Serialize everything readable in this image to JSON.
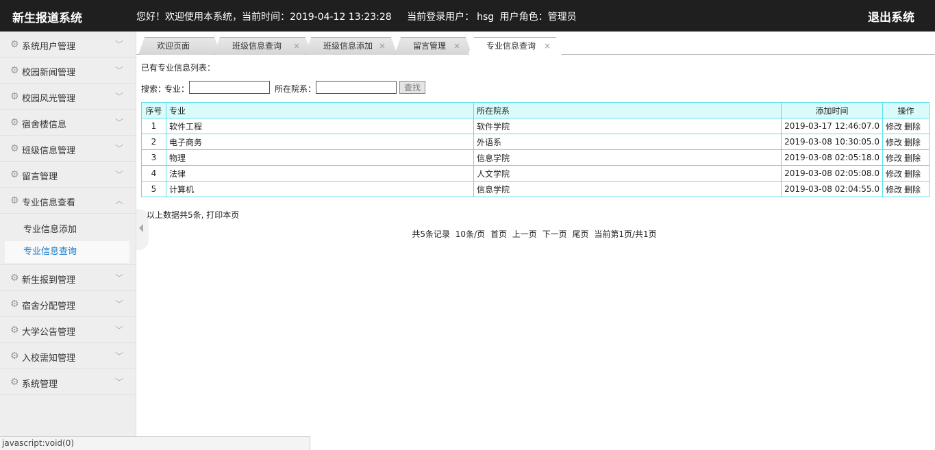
{
  "header": {
    "logo": "新生报道系统",
    "welcome": "您好！欢迎使用本系统，当前时间：2019-04-12 13:23:28",
    "user_label": "当前登录用户：",
    "user": "hsg",
    "role": "用户角色：管理员",
    "exit": "退出系统"
  },
  "sidebar": {
    "items": [
      {
        "label": "系统用户管理"
      },
      {
        "label": "校园新闻管理"
      },
      {
        "label": "校园风光管理"
      },
      {
        "label": "宿舍楼信息"
      },
      {
        "label": "班级信息管理"
      },
      {
        "label": "留言管理"
      },
      {
        "label": "专业信息查看"
      },
      {
        "label": "新生报到管理"
      },
      {
        "label": "宿舍分配管理"
      },
      {
        "label": "大学公告管理"
      },
      {
        "label": "入校需知管理"
      },
      {
        "label": "系统管理"
      }
    ],
    "sub_items": [
      {
        "label": "专业信息添加"
      },
      {
        "label": "专业信息查询"
      }
    ]
  },
  "tabs": [
    {
      "label": "欢迎页面"
    },
    {
      "label": "班级信息查询"
    },
    {
      "label": "班级信息添加"
    },
    {
      "label": "留言管理"
    },
    {
      "label": "专业信息查询"
    }
  ],
  "icons": {
    "tab_close": "×",
    "expand": "chevron-down-icon",
    "collapse": "chevron-up-icon",
    "menu": "gear-icon"
  },
  "main": {
    "list_title": "已有专业信息列表：",
    "search_label": "搜索：",
    "major_label": "专业：",
    "major_value": "",
    "dept_label": "所在院系：",
    "dept_value": "",
    "search_button": "查找",
    "table": {
      "headers": [
        "序号",
        "专业",
        "所在院系",
        "添加时间",
        "操作"
      ],
      "rows": [
        {
          "no": "1",
          "major": "软件工程",
          "dept": "软件学院",
          "time": "2019-03-17 12:46:07.0"
        },
        {
          "no": "2",
          "major": "电子商务",
          "dept": "外语系",
          "time": "2019-03-08 10:30:05.0"
        },
        {
          "no": "3",
          "major": "物理",
          "dept": "信息学院",
          "time": "2019-03-08 02:05:18.0"
        },
        {
          "no": "4",
          "major": "法律",
          "dept": "人文学院",
          "time": "2019-03-08 02:05:08.0"
        },
        {
          "no": "5",
          "major": "计算机",
          "dept": "信息学院",
          "time": "2019-03-08 02:04:55.0"
        }
      ],
      "edit": "修改",
      "delete": "删除"
    },
    "summary": "以上数据共5条,",
    "print": "打印本页",
    "pager": {
      "total": "共5条记录",
      "per_page": "10条/页",
      "first": "首页",
      "prev": "上一页",
      "next": "下一页",
      "last": "尾页",
      "current": "当前第1页/共1页"
    }
  },
  "statusbar": "javascript:void(0)"
}
